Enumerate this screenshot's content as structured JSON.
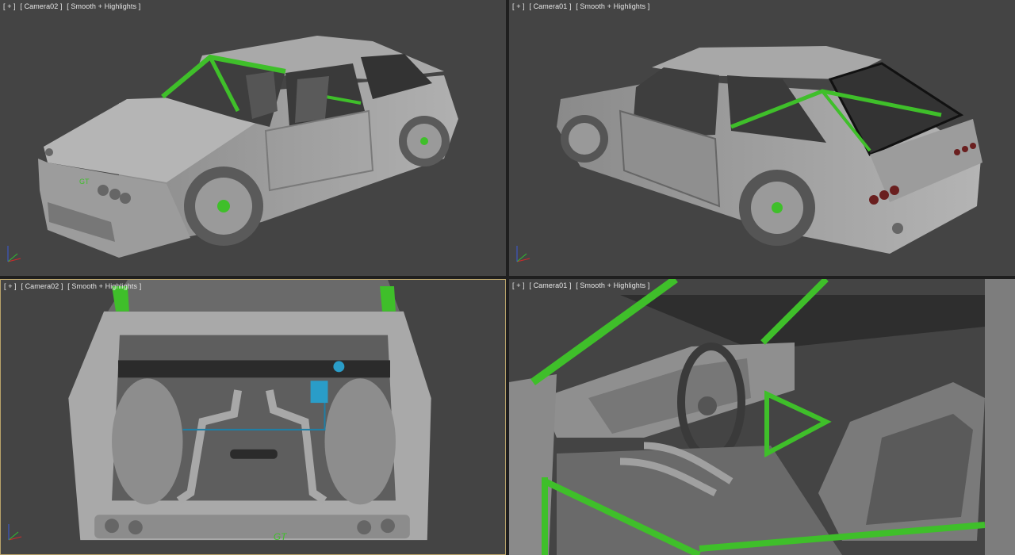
{
  "viewports": [
    {
      "plus": "[ + ]",
      "camera": "[ Camera02 ]",
      "shading": "[ Smooth + Highlights ]",
      "content": "car front three-quarter view"
    },
    {
      "plus": "[ + ]",
      "camera": "[ Camera01 ]",
      "shading": "[ Smooth + Highlights ]",
      "content": "car rear three-quarter view"
    },
    {
      "plus": "[ + ]",
      "camera": "[ Camera02 ]",
      "shading": "[ Smooth + Highlights ]",
      "content": "engine bay top view",
      "active": true
    },
    {
      "plus": "[ + ]",
      "camera": "[ Camera01 ]",
      "shading": "[ Smooth + Highlights ]",
      "content": "interior with roll cage and seat"
    }
  ],
  "colors": {
    "viewport_bg": "#444444",
    "body_gray": "#9a9a9a",
    "roll_cage_green": "#3fbf2a",
    "active_border": "#b8a26a",
    "axis_x": "#d02a2a",
    "axis_y": "#2fbf2f",
    "axis_z": "#3a5ad8"
  },
  "icons": [
    "axis-gizmo-icon"
  ]
}
